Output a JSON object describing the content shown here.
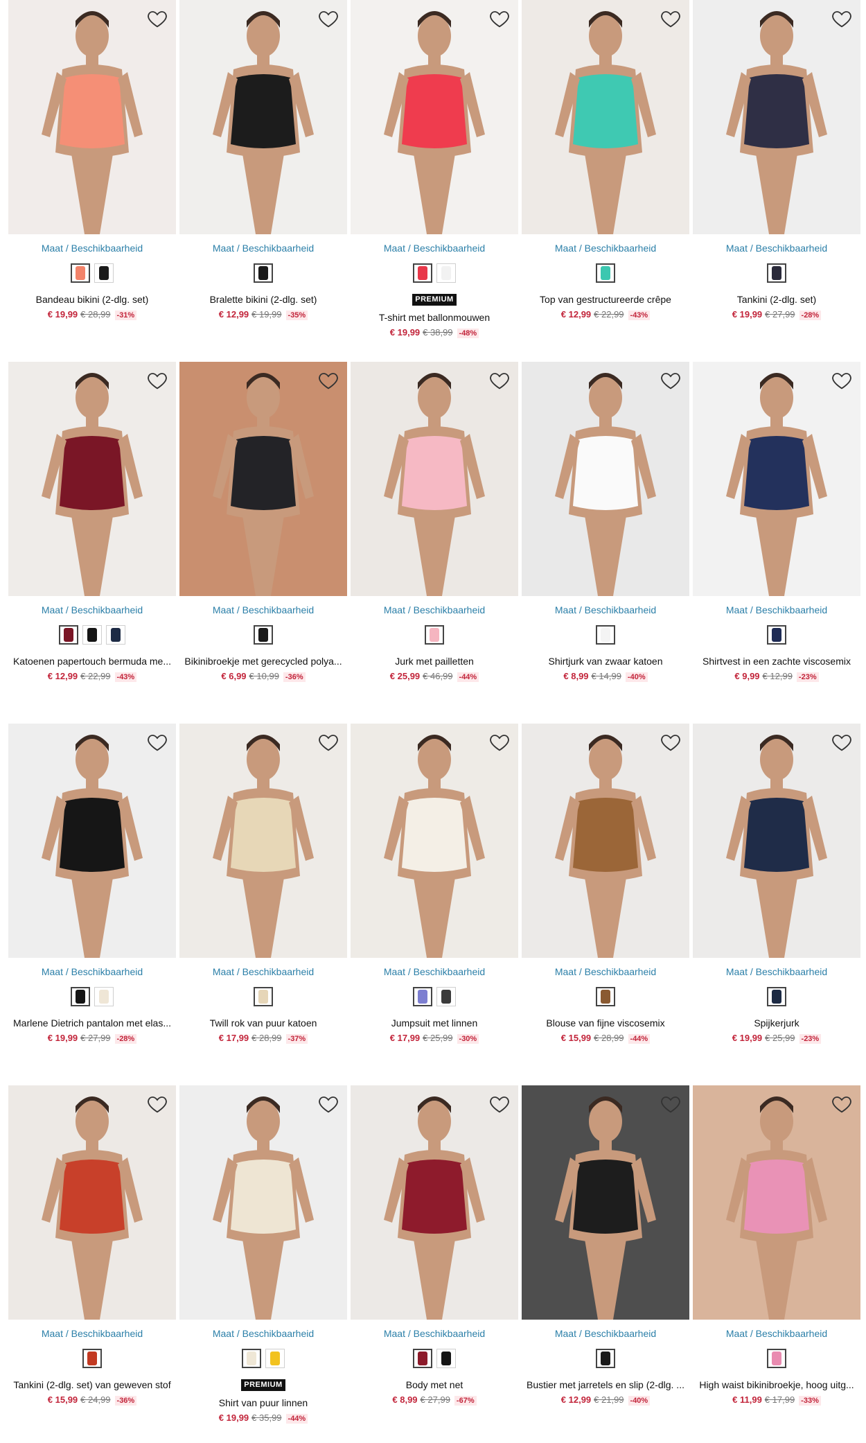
{
  "size_link_label": "Maat / Beschikbaarheid",
  "premium_label": "PREMIUM",
  "accent_link_color": "#2b7fa8",
  "price_color": "#c2243a",
  "products": [
    {
      "title": "Bandeau bikini (2-dlg. set)",
      "price": "€ 19,99",
      "old_price": "€ 28,99",
      "discount": "-31%",
      "premium": false,
      "swatches": [
        "#f3836a",
        "#1a1a1a"
      ],
      "icon": "bikini-coral-photo",
      "main": "#f58f76",
      "bg": "#f1ecea"
    },
    {
      "title": "Bralette bikini (2-dlg. set)",
      "price": "€ 12,99",
      "old_price": "€ 19,99",
      "discount": "-35%",
      "premium": false,
      "swatches": [
        "#1a1a1a"
      ],
      "icon": "bikini-black-photo",
      "main": "#1c1c1c",
      "bg": "#f0efed"
    },
    {
      "title": "T-shirt met ballonmouwen",
      "price": "€ 19,99",
      "old_price": "€ 38,99",
      "discount": "-48%",
      "premium": true,
      "swatches": [
        "#e8384a",
        "#f2f2f2"
      ],
      "icon": "tshirt-red-photo",
      "main": "#ef3c4e",
      "bg": "#f3f1ef"
    },
    {
      "title": "Top van gestructureerde crêpe",
      "price": "€ 12,99",
      "old_price": "€ 22,99",
      "discount": "-43%",
      "premium": false,
      "swatches": [
        "#3cc7b0"
      ],
      "icon": "top-turquoise-photo",
      "main": "#3fc9b2",
      "bg": "#eeeae6"
    },
    {
      "title": "Tankini (2-dlg. set)",
      "price": "€ 19,99",
      "old_price": "€ 27,99",
      "discount": "-28%",
      "premium": false,
      "swatches": [
        "#2a2a3a"
      ],
      "icon": "tankini-print-photo",
      "main": "#2f2f45",
      "bg": "#eeeeee"
    },
    {
      "title": "Katoenen papertouch bermuda me...",
      "price": "€ 12,99",
      "old_price": "€ 22,99",
      "discount": "-43%",
      "premium": false,
      "swatches": [
        "#7a1525",
        "#151515",
        "#1d2b45"
      ],
      "icon": "bermuda-red-photo",
      "main": "#7a1626",
      "bg": "#efece9"
    },
    {
      "title": "Bikinibroekje met gerecycled polya...",
      "price": "€ 6,99",
      "old_price": "€ 10,99",
      "discount": "-36%",
      "premium": false,
      "swatches": [
        "#1a1a1a"
      ],
      "icon": "bikini-brief-photo",
      "main": "#232327",
      "bg": "#c98f6f"
    },
    {
      "title": "Jurk met pailletten",
      "price": "€ 25,99",
      "old_price": "€ 46,99",
      "discount": "-44%",
      "premium": false,
      "swatches": [
        "#f5b5c0"
      ],
      "icon": "sequin-dress-photo",
      "main": "#f6b9c4",
      "bg": "#ece8e4"
    },
    {
      "title": "Shirtjurk van zwaar katoen",
      "price": "€ 8,99",
      "old_price": "€ 14,99",
      "discount": "-40%",
      "premium": false,
      "swatches": [
        "#f4f4f4"
      ],
      "icon": "white-dress-photo",
      "main": "#fafafa",
      "bg": "#e9e9e9"
    },
    {
      "title": "Shirtvest in een zachte viscosemix",
      "price": "€ 9,99",
      "old_price": "€ 12,99",
      "discount": "-23%",
      "premium": false,
      "swatches": [
        "#1e2b55"
      ],
      "icon": "navy-cardigan-photo",
      "main": "#23315c",
      "bg": "#f2f2f2"
    },
    {
      "title": "Marlene Dietrich pantalon met elas...",
      "price": "€ 19,99",
      "old_price": "€ 27,99",
      "discount": "-28%",
      "premium": false,
      "swatches": [
        "#151515",
        "#efe6d6"
      ],
      "icon": "black-pants-photo",
      "main": "#161616",
      "bg": "#eeeeee"
    },
    {
      "title": "Twill rok van puur katoen",
      "price": "€ 17,99",
      "old_price": "€ 28,99",
      "discount": "-37%",
      "premium": false,
      "swatches": [
        "#e6d6b8"
      ],
      "icon": "beige-skirt-photo",
      "main": "#e7d7b7",
      "bg": "#eeebe7"
    },
    {
      "title": "Jumpsuit met linnen",
      "price": "€ 17,99",
      "old_price": "€ 25,99",
      "discount": "-30%",
      "premium": false,
      "swatches": [
        "#7d7fd1",
        "#3a3a3a"
      ],
      "icon": "jumpsuit-print-photo",
      "main": "#f4efe6",
      "bg": "#eeebe6"
    },
    {
      "title": "Blouse van fijne viscosemix",
      "price": "€ 15,99",
      "old_price": "€ 28,99",
      "discount": "-44%",
      "premium": false,
      "swatches": [
        "#8a5a32"
      ],
      "icon": "leopard-blouse-photo",
      "main": "#9b6638",
      "bg": "#eceae8"
    },
    {
      "title": "Spijkerjurk",
      "price": "€ 19,99",
      "old_price": "€ 25,99",
      "discount": "-23%",
      "premium": false,
      "swatches": [
        "#1c2a44"
      ],
      "icon": "denim-dress-photo",
      "main": "#1f2c48",
      "bg": "#ecebea"
    },
    {
      "title": "Tankini (2-dlg. set) van geweven stof",
      "price": "€ 15,99",
      "old_price": "€ 24,99",
      "discount": "-36%",
      "premium": false,
      "swatches": [
        "#c23a22"
      ],
      "icon": "tankini-rust-photo",
      "main": "#c8402a",
      "bg": "#ede9e5"
    },
    {
      "title": "Shirt van puur linnen",
      "price": "€ 19,99",
      "old_price": "€ 35,99",
      "discount": "-44%",
      "premium": true,
      "swatches": [
        "#efe7d6",
        "#f2c21f"
      ],
      "icon": "linen-shirt-photo",
      "main": "#eee5d3",
      "bg": "#eeeeee"
    },
    {
      "title": "Body met net",
      "price": "€ 8,99",
      "old_price": "€ 27,99",
      "discount": "-67%",
      "premium": false,
      "swatches": [
        "#8c1a2a",
        "#151515"
      ],
      "icon": "mesh-body-photo",
      "main": "#8e1b2c",
      "bg": "#ece9e6"
    },
    {
      "title": "Bustier met jarretels en slip (2-dlg. ...",
      "price": "€ 12,99",
      "old_price": "€ 21,99",
      "discount": "-40%",
      "premium": false,
      "swatches": [
        "#1a1a1a"
      ],
      "icon": "bustier-black-photo",
      "main": "#1d1d1d",
      "bg": "#4e4e4e"
    },
    {
      "title": "High waist bikinibroekje, hoog uitg...",
      "price": "€ 11,99",
      "old_price": "€ 17,99",
      "discount": "-33%",
      "premium": false,
      "swatches": [
        "#e98bb0"
      ],
      "icon": "print-bikini-brief-photo",
      "main": "#e992b6",
      "bg": "#d9b49b"
    }
  ]
}
